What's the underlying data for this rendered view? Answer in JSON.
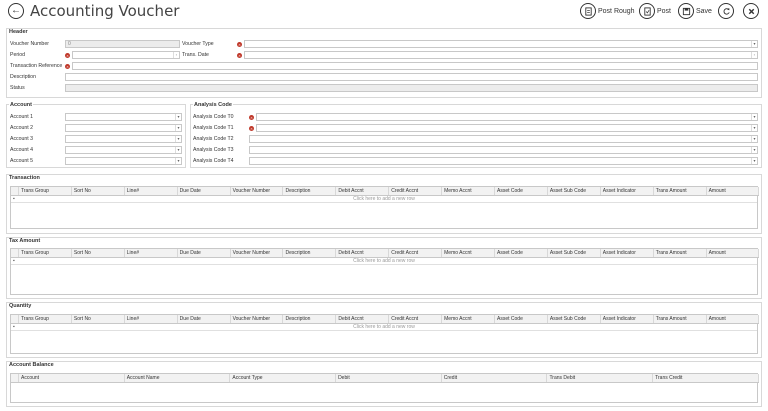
{
  "app": {
    "title": "Accounting Voucher"
  },
  "toolbar": {
    "post_rough": "Post Rough",
    "post": "Post",
    "save": "Save"
  },
  "header": {
    "title": "Header",
    "voucher_number_label": "Voucher Number",
    "voucher_number_value": "0",
    "voucher_type_label": "Voucher Type",
    "period_label": "Period",
    "trans_date_label": "Trans. Date",
    "transaction_reference_label": "Transaction Reference",
    "description_label": "Description",
    "status_label": "Status"
  },
  "account": {
    "title": "Account",
    "labels": [
      "Account 1",
      "Account 2",
      "Account 3",
      "Account 4",
      "Account 5"
    ]
  },
  "analysis": {
    "title": "Analysis Code",
    "labels": [
      "Analysis Code T0",
      "Analysis Code T1",
      "Analysis Code T2",
      "Analysis Code T3",
      "Analysis Code T4"
    ]
  },
  "transaction": {
    "title": "Transaction",
    "columns": [
      "Trans Group",
      "Sort No",
      "Line#",
      "Due Date",
      "Voucher Number",
      "Description",
      "Debit Accnt",
      "Credit Accnt",
      "Memo Accnt",
      "Asset Code",
      "Asset Sub Code",
      "Asset Indicator",
      "Trans Amount",
      "Amount"
    ],
    "add_row": "Click here to add a new row"
  },
  "tax": {
    "title": "Tax Amount",
    "columns": [
      "Trans Group",
      "Sort No",
      "Line#",
      "Due Date",
      "Voucher Number",
      "Description",
      "Debit Accnt",
      "Credit Accnt",
      "Memo Accnt",
      "Asset Code",
      "Asset Sub Code",
      "Asset Indicator",
      "Trans Amount",
      "Amount"
    ],
    "add_row": "Click here to add a new row"
  },
  "quantity": {
    "title": "Quantity",
    "columns": [
      "Trans Group",
      "Sort No",
      "Line#",
      "Due Date",
      "Voucher Number",
      "Description",
      "Debit Accnt",
      "Credit Accnt",
      "Memo Accnt",
      "Asset Code",
      "Asset Sub Code",
      "Asset Indicator",
      "Trans Amount",
      "Amount"
    ],
    "add_row": "Click here to add a new row"
  },
  "balance": {
    "title": "Account Balance",
    "columns": [
      "Account",
      "Account Name",
      "Account Type",
      "Debit",
      "Credit",
      "Trans Debit",
      "Trans Credit"
    ]
  }
}
